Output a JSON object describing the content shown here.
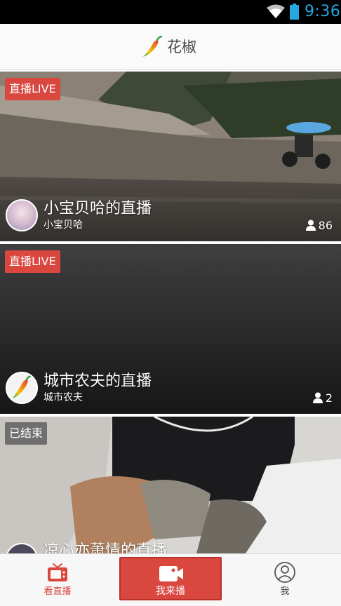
{
  "status_bar": {
    "time": "9:36",
    "wifi_icon": "wifi-icon",
    "battery_icon": "battery-icon"
  },
  "header": {
    "app_name": "花椒",
    "logo_icon": "chili-pepper-logo"
  },
  "feed": [
    {
      "badge": "直播LIVE",
      "status": "live",
      "title": "小宝贝哈的直播",
      "host": "小宝贝哈",
      "viewers": "86"
    },
    {
      "badge": "直播LIVE",
      "status": "live",
      "title": "城市农夫的直播",
      "host": "城市农夫",
      "viewers": "2"
    },
    {
      "badge": "已结束",
      "status": "ended",
      "title": "凉心亦萧情的直播",
      "host": "",
      "viewers": ""
    }
  ],
  "bottom_nav": {
    "watch": {
      "label": "看直播",
      "icon": "tv-icon",
      "active": true
    },
    "broadcast": {
      "label": "我来播",
      "icon": "camera-icon"
    },
    "me": {
      "label": "我",
      "icon": "profile-icon"
    }
  },
  "colors": {
    "accent": "#d9473f",
    "status_time": "#25a7df",
    "ended_badge": "#6f6f6f"
  }
}
